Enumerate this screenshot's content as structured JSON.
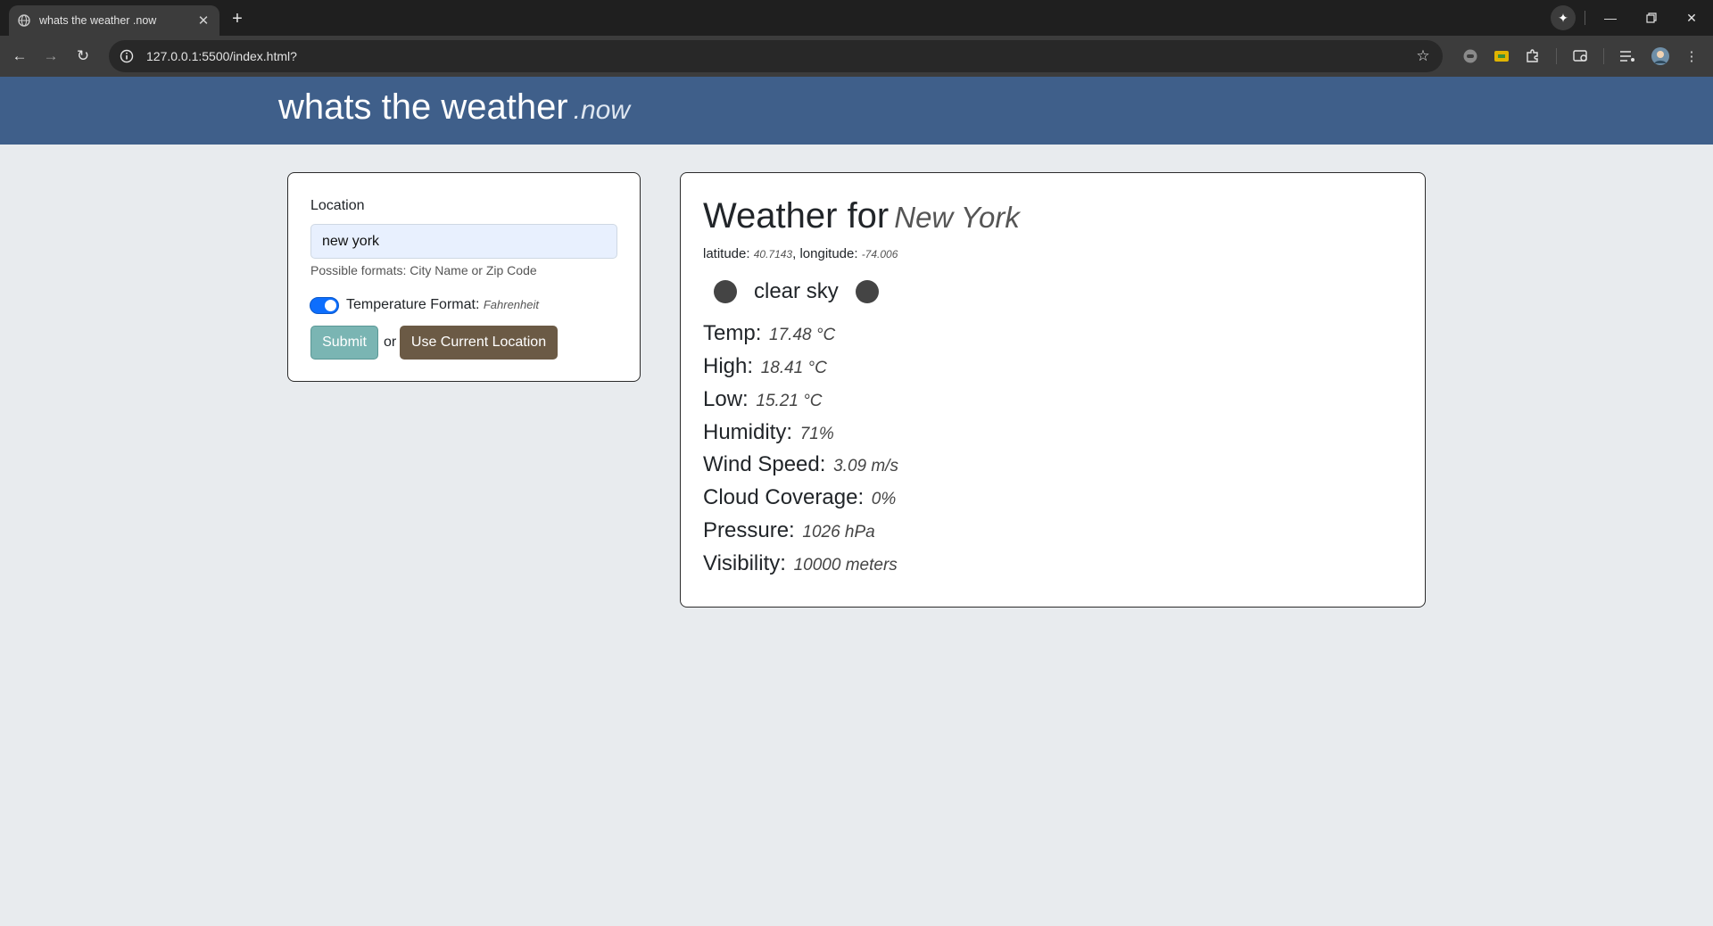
{
  "browser": {
    "tab_title": "whats the weather .now",
    "url": "127.0.0.1:5500/index.html?"
  },
  "header": {
    "brand": "whats the weather",
    "brand_suffix": ".now"
  },
  "form": {
    "location_label": "Location",
    "location_value": "new york",
    "help_text": "Possible formats: City Name or Zip Code",
    "toggle_on": true,
    "temp_format_label": "Temperature Format:",
    "temp_format_value": "Fahrenheit",
    "submit_label": "Submit",
    "or_text": "or",
    "use_location_label": "Use Current Location"
  },
  "weather": {
    "title_prefix": "Weather for",
    "city": "New York",
    "lat_label": "latitude:",
    "lat_value": "40.7143",
    "lon_label": "longitude:",
    "lon_value": "-74.006",
    "condition": "clear sky",
    "stats": [
      {
        "label": "Temp:",
        "value": "17.48 °C"
      },
      {
        "label": "High:",
        "value": "18.41 °C"
      },
      {
        "label": "Low:",
        "value": "15.21 °C"
      },
      {
        "label": "Humidity:",
        "value": "71%"
      },
      {
        "label": "Wind Speed:",
        "value": "3.09 m/s"
      },
      {
        "label": "Cloud Coverage:",
        "value": "0%"
      },
      {
        "label": "Pressure:",
        "value": "1026 hPa"
      },
      {
        "label": "Visibility:",
        "value": "10000 meters"
      }
    ]
  }
}
